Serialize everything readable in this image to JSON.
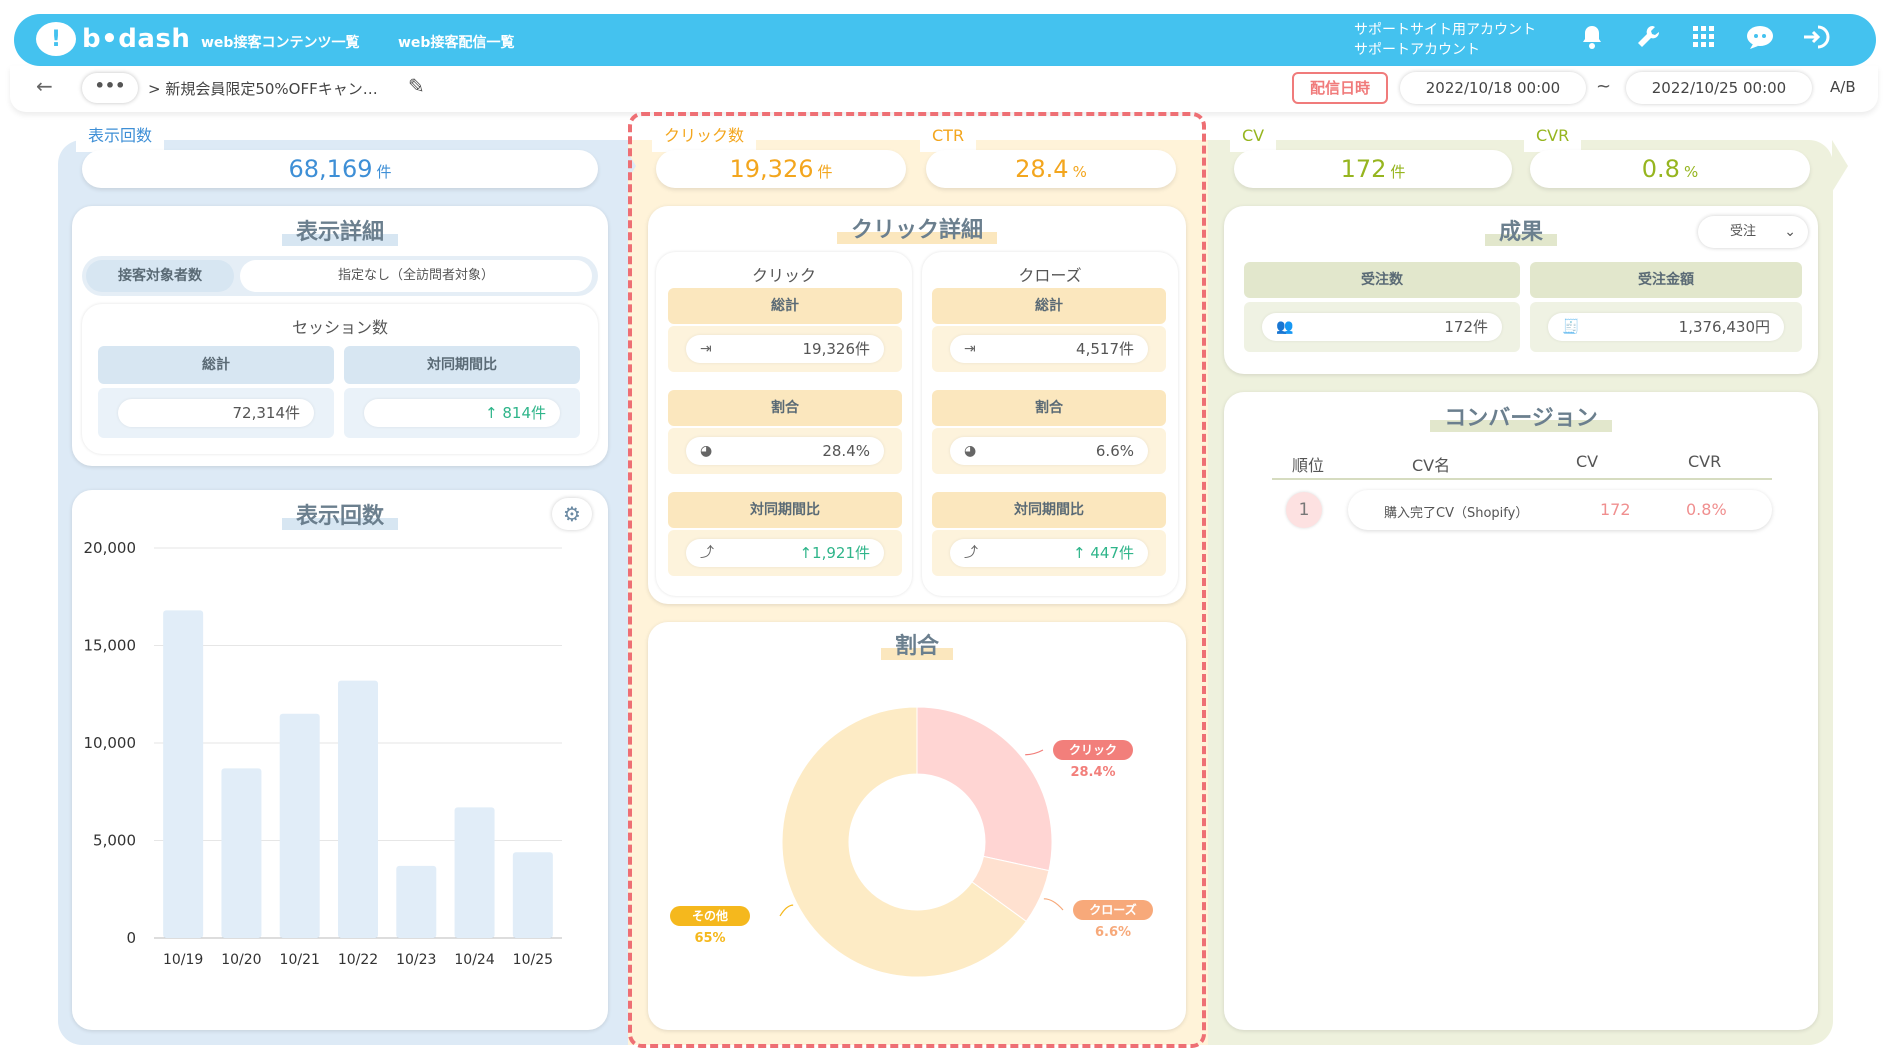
{
  "header": {
    "logo_glyph": "!",
    "logo_text": "b•dash",
    "nav": [
      "web接客コンテンツ一覧",
      "web接客配信一覧"
    ],
    "account_line1": "サポートサイト用アカウント",
    "account_line2": "サポートアカウント",
    "icons": [
      "bell-icon",
      "wrench-icon",
      "grid-icon",
      "chat-icon",
      "logout-icon"
    ]
  },
  "toolbar": {
    "dots": "•••",
    "breadcrumb": "> 新規会員限定50%OFFキャン…",
    "dist_label": "配信日時",
    "start": "2022/10/18 00:00",
    "tilde": "~",
    "end": "2022/10/25 00:00",
    "ab": "A/B"
  },
  "metrics": {
    "impressions": {
      "label": "表示回数",
      "value": "68,169",
      "unit": "件"
    },
    "clicks": {
      "label": "クリック数",
      "value": "19,326",
      "unit": "件"
    },
    "ctr": {
      "label": "CTR",
      "value": "28.4",
      "unit": "%"
    },
    "cv": {
      "label": "CV",
      "value": "172",
      "unit": "件"
    },
    "cvr": {
      "label": "CVR",
      "value": "0.8",
      "unit": "%"
    }
  },
  "display_detail": {
    "title": "表示詳細",
    "tab_active": "接客対象者数",
    "tab_value": "指定なし（全訪問者対象）",
    "session_title": "セッション数",
    "total_label": "総計",
    "yoy_label": "対同期間比",
    "total_value": "72,314件",
    "yoy_value": "↑ 814件"
  },
  "impressions_chart_title": "表示回数",
  "chart_data": {
    "type": "bar",
    "categories": [
      "10/19",
      "10/20",
      "10/21",
      "10/22",
      "10/23",
      "10/24",
      "10/25"
    ],
    "values": [
      16800,
      8700,
      11500,
      13200,
      3700,
      6700,
      4400
    ],
    "ylim": [
      0,
      20000
    ],
    "yticks": [
      "0",
      "5,000",
      "10,000",
      "15,000",
      "20,000"
    ],
    "bar_color": "#e1edf8"
  },
  "click_detail": {
    "title": "クリック詳細",
    "click": {
      "title": "クリック",
      "total_label": "総計",
      "total": "19,326件",
      "ratio_label": "割合",
      "ratio": "28.4%",
      "yoy_label": "対同期間比",
      "yoy": "↑1,921件"
    },
    "close": {
      "title": "クローズ",
      "total_label": "総計",
      "total": "4,517件",
      "ratio_label": "割合",
      "ratio": "6.6%",
      "yoy_label": "対同期間比",
      "yoy": "↑ 447件"
    }
  },
  "ratio_chart": {
    "title": "割合",
    "slices": [
      {
        "name": "クリック",
        "pct": 28.4,
        "label": "28.4%",
        "color": "#ffd5d3",
        "tag_color": "#f27f7b"
      },
      {
        "name": "クローズ",
        "pct": 6.6,
        "label": "6.6%",
        "color": "#ffe1d0",
        "tag_color": "#f7a97a"
      },
      {
        "name": "その他",
        "pct": 65,
        "label": "65%",
        "color": "#fdebc5",
        "tag_color": "#f5b81d"
      }
    ]
  },
  "results": {
    "title": "成果",
    "select": "受注",
    "orders_label": "受注数",
    "amount_label": "受注金額",
    "orders": "172件",
    "amount": "1,376,430円"
  },
  "conversion": {
    "title": "コンバージョン",
    "headers": [
      "順位",
      "CV名",
      "CV",
      "CVR"
    ],
    "rows": [
      {
        "rank": "1",
        "name": "購入完了CV（Shopify）",
        "cv": "172",
        "cvr": "0.8%"
      }
    ]
  }
}
